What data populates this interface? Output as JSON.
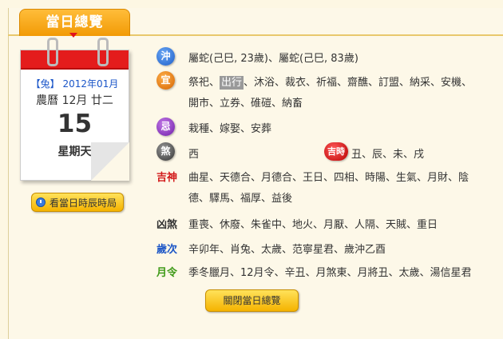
{
  "header": {
    "tab_title": "當日總覽"
  },
  "calendar": {
    "zodiac_year": "【兔】",
    "solar_month": "2012年01月",
    "lunar_date": "農曆 12月 廿二",
    "day": "15",
    "weekday": "星期天"
  },
  "hour_button": {
    "label": "看當日時辰時局"
  },
  "rows": {
    "chong": {
      "icon_text": "沖",
      "text": "屬蛇(己巳,  23歲)、屬蛇(己巳,  83歲)"
    },
    "yi": {
      "icon_text": "宜",
      "text_before": "祭祀、",
      "text_highlight": "出行",
      "text_after": "、沐浴、裁衣、祈福、齋醮、訂盟、納采、安機、",
      "text_line2": "開市、立券、碓磑、納畜"
    },
    "ji": {
      "icon_text": "忌",
      "text": "栽種、嫁娶、安葬"
    },
    "sha": {
      "icon_text": "煞",
      "text": "西"
    },
    "jishi": {
      "icon_text": "吉時",
      "text": "丑、辰、未、戌"
    },
    "jishen": {
      "label": "吉神",
      "text_line1": "曲星、天德合、月德合、王日、四相、時陽、生氣、月財、陰",
      "text_line2": "德、驛馬、福厚、益後"
    },
    "xiongsha": {
      "label": "凶煞",
      "text": "重喪、休廢、朱雀中、地火、月厭、人隔、天賊、重日"
    },
    "suici": {
      "label": "歲次",
      "text": "辛卯年、肖兔、太歲、范寧星君、歲沖乙酉"
    },
    "yueling": {
      "label": "月令",
      "text": "季冬臘月、12月令、辛丑、月煞東、月將丑、太歲、湯信星君"
    }
  },
  "close_button": {
    "label": "關閉當日總覽"
  },
  "icons": {
    "chong": "clash-badge-icon",
    "yi": "suitable-badge-icon",
    "ji": "avoid-badge-icon",
    "sha": "evil-badge-icon",
    "jishi": "lucky-hour-badge-icon",
    "clock": "clock-icon"
  },
  "colors": {
    "tab": "#f7a612",
    "calendar_red": "#e41c1c",
    "label_red": "#d21818",
    "label_blue": "#1b55c6",
    "label_green": "#3f9a18"
  }
}
